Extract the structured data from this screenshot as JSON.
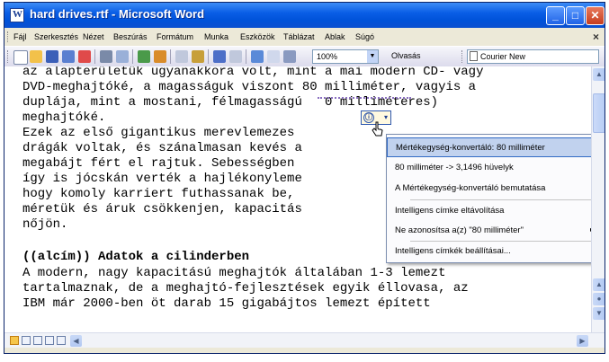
{
  "window": {
    "title": "hard drives.rtf - Microsoft Word",
    "buttons": {
      "minimize": "_",
      "maximize": "□",
      "close": "✕"
    }
  },
  "menubar": {
    "items": [
      "Fájl",
      "Szerkesztés",
      "Nézet",
      "Beszúrás",
      "Formátum",
      "Munka",
      "Eszközök",
      "Táblázat",
      "Ablak",
      "Súgó"
    ],
    "close": "×"
  },
  "toolbar": {
    "zoom": "100%",
    "olvasas": "Olvasás",
    "font": "Courier New"
  },
  "document": {
    "lines": [
      "az alapterületük ugyanakkora volt, mint a mai modern CD- vagy",
      "DVD-meghajtóké, a magasságuk viszont 80 milliméter, vagyis a",
      "duplája, mint a mostani, félmagasságú   0 milliméteres)",
      "meghajtóké.",
      "Ezek az első gigantikus merevlemezes",
      "drágák voltak, és szánalmasan kevés a",
      "megabájt fért el rajtuk. Sebességben",
      "így is jócskán verték a hajlékonyleme",
      "hogy komoly karriert futhassanak be,",
      "méretük és áruk csökkenjen, kapacitás",
      "nőjön.",
      "",
      "((alcím)) Adatok a cilinderben",
      "A modern, nagy kapacitású meghajtók általában 1-3 lemezt",
      "tartalmaznak, de a meghajtó-fejlesztések egyik éllovasa, az",
      "IBM már 2000-ben öt darab 15 gigabájtos lemezt épített"
    ],
    "smart_tag_text": "80 milliméter"
  },
  "smart_tag": {
    "icon": "ⓘ",
    "arrow": "▾"
  },
  "smart_tag_menu": {
    "items": [
      "Mértékegység-konvertáló: 80 milliméter",
      "80 milliméter -> 3,1496 hüvelyk",
      "A Mértékegység-konvertáló bemutatása",
      "Intelligens címke eltávolítása",
      "Ne azonosítsa a(z) \"80 milliméter\"",
      "Intelligens címkék beállításai..."
    ],
    "submenu_arrow": "▸"
  },
  "colors": {
    "title_bar": "#0a5ee6",
    "menu_highlight": "#c1d2ee",
    "smart_tag_underline": "#8a6fc0"
  }
}
